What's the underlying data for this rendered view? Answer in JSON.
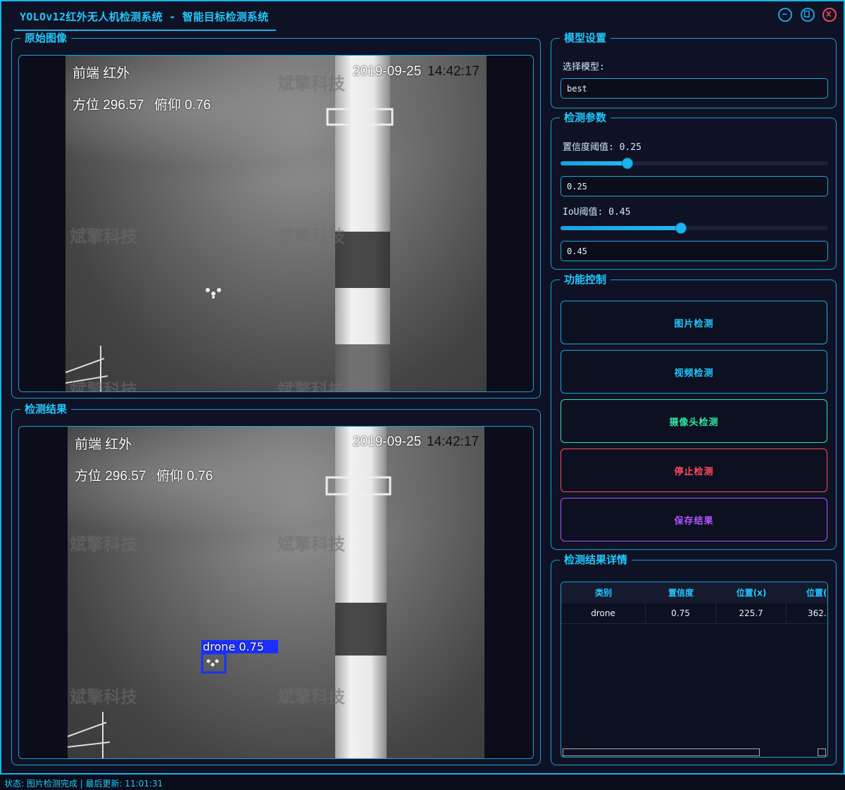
{
  "window": {
    "title": "YOLOv12红外无人机检测系统 - 智能目标检测系统",
    "minimize_icon": "minimize-icon",
    "maximize_icon": "maximize-icon",
    "close_icon": "close-icon"
  },
  "original_panel": {
    "title": "原始图像",
    "overlay": {
      "label1": "前端  红外",
      "datetime_date": "2019-09-25",
      "datetime_time": "14:42:17",
      "azimuth": "方位 296.57",
      "pitch": "俯仰 0.76"
    },
    "watermark": "斌擎科技"
  },
  "result_panel": {
    "title": "检测结果",
    "overlay": {
      "label1": "前端  红外",
      "datetime_date": "2019-09-25",
      "datetime_time": "14:42:17",
      "azimuth": "方位 296.57",
      "pitch": "俯仰 0.76"
    },
    "detection_label": "drone  0.75",
    "watermark": "斌擎科技"
  },
  "model_settings": {
    "title": "模型设置",
    "select_label": "选择模型:",
    "model_value": "best"
  },
  "detection_params": {
    "title": "检测参数",
    "confidence_label": "置信度阈值: 0.25",
    "confidence_value": "0.25",
    "confidence_level": 0.25,
    "iou_label": "IoU阈值: 0.45",
    "iou_value": "0.45",
    "iou_level": 0.45
  },
  "controls": {
    "title": "功能控制",
    "image_detect": "图片检测",
    "video_detect": "视频检测",
    "camera_detect": "摄像头检测",
    "stop_detect": "停止检测",
    "save_result": "保存结果"
  },
  "details": {
    "title": "检测结果详情",
    "columns": [
      "类别",
      "置信度",
      "位置(x)",
      "位置("
    ],
    "rows": [
      [
        "drone",
        "0.75",
        "225.7",
        "362."
      ]
    ]
  },
  "status": {
    "text": "状态: 图片检测完成 | 最后更新: 11:01:31"
  },
  "colors": {
    "accent": "#22c8ff",
    "camera_button": "#2ee6a6",
    "stop_button": "#ff4d5e",
    "save_button": "#b055ff",
    "detection_box": "#1b2fff"
  }
}
